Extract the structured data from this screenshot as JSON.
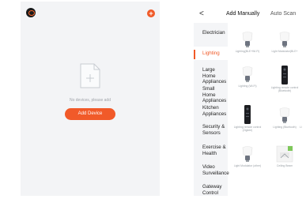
{
  "home": {
    "empty_message": "No devices, please add",
    "add_device_label": "Add Device",
    "plus_symbol": "+"
  },
  "add_screen": {
    "back_symbol": "<",
    "tabs": [
      {
        "label": "Add Manually",
        "active": true
      },
      {
        "label": "Auto Scan",
        "active": false
      }
    ],
    "categories": [
      {
        "label": "Electrician",
        "active": false
      },
      {
        "label": "Lighting",
        "active": true
      },
      {
        "label": "Large Home Appliances",
        "active": false
      },
      {
        "label": "Small Home Appliances",
        "active": false
      },
      {
        "label": "Kitchen Appliances",
        "active": false
      },
      {
        "label": "Security & Sensors",
        "active": false
      },
      {
        "label": "Exercise & Health",
        "active": false
      },
      {
        "label": "Video Surveillance",
        "active": false
      },
      {
        "label": "Gateway Control",
        "active": false
      }
    ],
    "products": [
      {
        "label": "Lighting(BLE+Wi-Fi)",
        "icon": "bulb-icon"
      },
      {
        "label": "Light Modulator(BLE+",
        "icon": "bulb-icon"
      },
      {
        "label": "Lighting (Wi-Fi)",
        "icon": "bulb-icon"
      },
      {
        "label": "Lighting remote control (Bluetooth)",
        "icon": "remote-icon"
      },
      {
        "label": "Lighting remote control (Zigbee)",
        "icon": "remote-icon"
      },
      {
        "label": "Lighting (Bluetooth)",
        "icon": "bulb-icon"
      },
      {
        "label": "Light Modulator (other)",
        "icon": "bulb-icon"
      },
      {
        "label": "Ceiling Beam",
        "icon": "ceiling-light-icon"
      }
    ],
    "partial_label": "Li"
  },
  "colors": {
    "accent": "#f05a28",
    "background": "#f3f4f6",
    "muted_text": "#a0a4aa"
  }
}
